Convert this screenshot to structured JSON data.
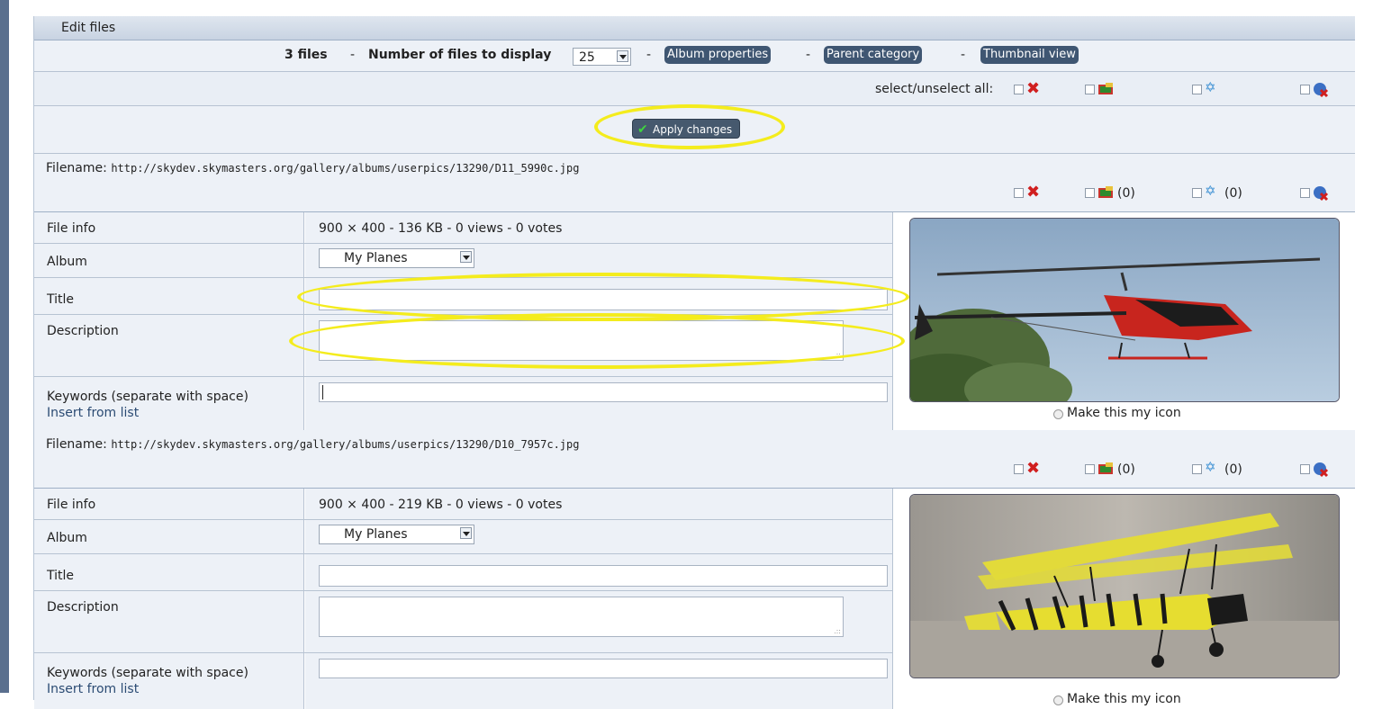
{
  "header": {
    "title": "Edit files"
  },
  "nav": {
    "file_count": "3 files",
    "sep": "-",
    "display_label": "Number of files to display",
    "display_value": "25",
    "album_properties": "Album properties",
    "parent_category": "Parent category",
    "thumbnail_view": "Thumbnail view"
  },
  "select_all": {
    "label": "select/unselect all:"
  },
  "apply": {
    "label": "Apply changes"
  },
  "files": [
    {
      "filename_label": "Filename:",
      "filename": "http://skydev.skymasters.org/gallery/albums/userpics/13290/D11_5990c.jpg",
      "approve_count": "(0)",
      "star_count": "(0)",
      "file_info_label": "File info",
      "file_info": "900 × 400 - 136 KB - 0 views - 0 votes",
      "album_label": "Album",
      "album": "My Planes",
      "title_label": "Title",
      "title": "",
      "description_label": "Description",
      "description": "",
      "keywords_label": "Keywords (separate with space)",
      "insert_from_list": "Insert from list",
      "keywords": "",
      "make_icon": "Make this my icon"
    },
    {
      "filename_label": "Filename:",
      "filename": "http://skydev.skymasters.org/gallery/albums/userpics/13290/D10_7957c.jpg",
      "approve_count": "(0)",
      "star_count": "(0)",
      "file_info_label": "File info",
      "file_info": "900 × 400 - 219 KB - 0 views - 0 votes",
      "album_label": "Album",
      "album": "My Planes",
      "title_label": "Title",
      "title": "",
      "description_label": "Description",
      "description": "",
      "keywords_label": "Keywords (separate with space)",
      "insert_from_list": "Insert from list",
      "keywords": "",
      "make_icon": "Make this my icon"
    }
  ],
  "colors": {
    "highlight": "#f4ec1d",
    "nav_pill": "#3f5672",
    "panel": "#edf1f7"
  }
}
